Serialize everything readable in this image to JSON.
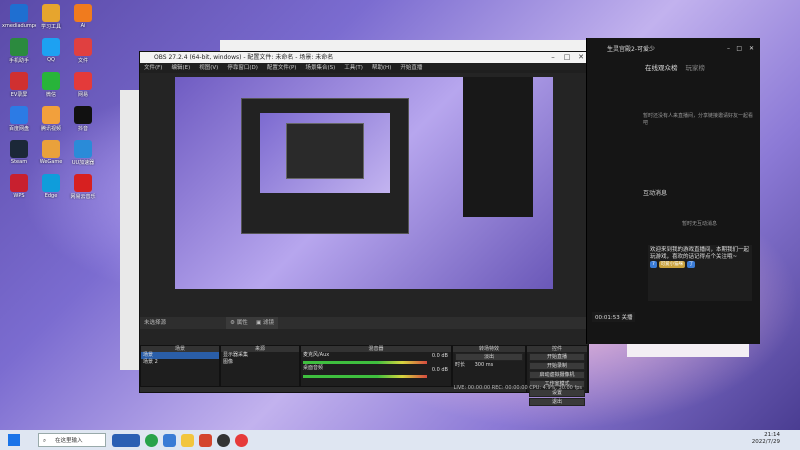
{
  "desktop": {
    "icons": [
      {
        "label": "xmediadumper",
        "color": "#1f6fd1"
      },
      {
        "label": "学习工具",
        "color": "#e6a52e"
      },
      {
        "label": "Ai",
        "color": "#f07b1e"
      },
      {
        "label": "手机助手",
        "color": "#2b8a3e"
      },
      {
        "label": "QQ",
        "color": "#1da1f2"
      },
      {
        "label": "文件",
        "color": "#e04040"
      },
      {
        "label": "EV录屏",
        "color": "#d03030"
      },
      {
        "label": "微信",
        "color": "#28b43a"
      },
      {
        "label": "网易",
        "color": "#e43a3a"
      },
      {
        "label": "百度网盘",
        "color": "#2c7be5"
      },
      {
        "label": "腾讯视频",
        "color": "#f2a03c"
      },
      {
        "label": "抖音",
        "color": "#111111"
      },
      {
        "label": "Steam",
        "color": "#1b2838"
      },
      {
        "label": "WeGame",
        "color": "#e9a13b"
      },
      {
        "label": "UU加速器",
        "color": "#2a8bd8"
      },
      {
        "label": "WPS",
        "color": "#c8202f"
      },
      {
        "label": "Edge",
        "color": "#0f9ddb"
      },
      {
        "label": "网易云音乐",
        "color": "#d72020"
      }
    ]
  },
  "obs": {
    "title": "OBS 27.2.4 (64-bit, windows) - 配置文件: 未命名 - 场景: 未命名",
    "menu": [
      "文件(F)",
      "编辑(E)",
      "视图(V)",
      "停靠窗口(D)",
      "配置文件(P)",
      "场景集合(S)",
      "工具(T)",
      "帮助(H)",
      "开始直播"
    ],
    "source_bar_label": "未选择源",
    "properties_label": "属性",
    "filters_label": "滤镜",
    "docks": {
      "scenes": {
        "header": "场景",
        "items": [
          "场景",
          "场景 2"
        ]
      },
      "sources": {
        "header": "来源",
        "items": [
          "显示器采集",
          "图像"
        ]
      },
      "mixer": {
        "header": "混音器",
        "channels": [
          {
            "name": "麦克风/Aux",
            "db": "0.0 dB"
          },
          {
            "name": "桌面音频",
            "db": "0.0 dB"
          }
        ]
      },
      "transitions": {
        "header": "转场特效",
        "type": "淡出",
        "duration_label": "时长",
        "duration": "300 ms"
      },
      "controls": {
        "header": "控件",
        "buttons": [
          "开始直播",
          "开始录制",
          "启动虚拟摄像机",
          "工作室模式",
          "设置",
          "退出"
        ]
      }
    },
    "status": "LIVE: 00:00:00   REC: 00:00:00   CPU: 4.9%, 30.00 fps"
  },
  "live": {
    "title": "生灵宫殿2-可爱少",
    "tabs": [
      "在线观众榜",
      "玩家榜"
    ],
    "viewers_empty": "暂时还没有人来直播间，分享链接邀请好友一起看吧",
    "interact_header": "互动消息",
    "interact_empty": "暂时无互动消息",
    "timer": "00:01:53 关播",
    "chat_text": "欢迎来到我的游戏直播间，本期我们一起玩游戏，喜欢的话记得点个关注哦~",
    "badges": [
      "7",
      "可爱小猫咪",
      "了"
    ]
  },
  "taskbar": {
    "search_placeholder": "在这里输入",
    "time": "21:14",
    "date": "2022/7/29"
  }
}
